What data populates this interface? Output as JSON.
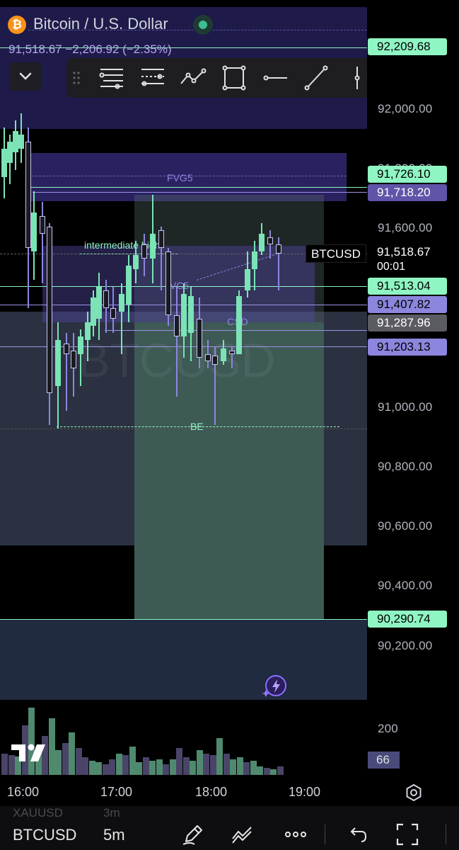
{
  "header": {
    "coin_symbol": "₿",
    "title": "Bitcoin / U.S. Dollar",
    "quote": "91,518.67  −2,206.92 (−2.35%)"
  },
  "toolbar": {
    "icons": [
      "drag-handle-icon",
      "fib-retracement-icon",
      "fib-extension-icon",
      "pattern-icon",
      "rectangle-icon",
      "horizontal-ray-icon",
      "trend-line-icon",
      "vertical-line-icon",
      "more-lines-icon"
    ]
  },
  "price_scale": {
    "ticks": [
      "92,000.00",
      "91,800.00",
      "91,600.00",
      "91,000.00",
      "90,800.00",
      "90,600.00",
      "90,400.00",
      "90,200.00"
    ],
    "tags": {
      "top_level": "92,209.68",
      "fvg_top": "91,726.10",
      "fvg_bottom": "91,718.20",
      "last_price": "91,518.67",
      "countdown": "00:01",
      "level_1": "91,513.04",
      "level_2": "91,407.82",
      "level_3": "91,287.96",
      "level_4": "91,203.13",
      "stop_level": "90,290.74"
    },
    "symbol_tag": "BTCUSD"
  },
  "annotations": {
    "fvg": "FVG5",
    "intermediate_high": "intermediate high",
    "vc": "VC5",
    "csd": "CSD",
    "be": "BE",
    "watermark": "BTCUSD"
  },
  "volume": {
    "scale_tick": "200",
    "current": "66"
  },
  "time_axis": {
    "labels": [
      "16:00",
      "17:00",
      "18:00",
      "19:00"
    ]
  },
  "bottom_bar": {
    "ghost_symbol": "XAUUSD",
    "ghost_interval": "3m",
    "symbol": "BTCUSD",
    "interval": "5m"
  },
  "colors": {
    "up": "#7be3b5",
    "down": "#1a1a22",
    "purple_zone": "#2a1f5c",
    "green_zone": "#3c5a52",
    "accent_green": "#8ff5c3",
    "accent_purple": "#8c86de"
  }
}
